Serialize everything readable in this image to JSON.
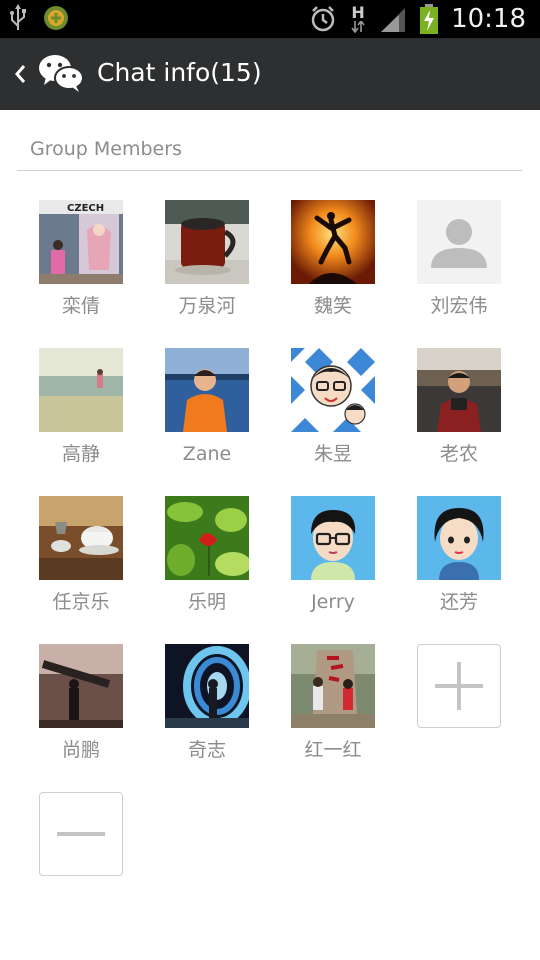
{
  "status_bar": {
    "time": "10:18",
    "network_type": "H",
    "icons": [
      "usb-icon",
      "app-notification-icon",
      "alarm-icon",
      "network-h-icon",
      "signal-icon",
      "battery-charging-icon"
    ]
  },
  "header": {
    "title": "Chat info(15)",
    "back_icon": "back-chevron-icon",
    "logo_icon": "wechat-logo-icon"
  },
  "section": {
    "title": "Group Members"
  },
  "members": [
    {
      "name": "栾倩"
    },
    {
      "name": "万泉河"
    },
    {
      "name": "魏笑"
    },
    {
      "name": "刘宏伟"
    },
    {
      "name": "高静"
    },
    {
      "name": "Zane"
    },
    {
      "name": "朱昱"
    },
    {
      "name": "老农"
    },
    {
      "name": "任京乐"
    },
    {
      "name": "乐明"
    },
    {
      "name": "Jerry"
    },
    {
      "name": "还芳"
    },
    {
      "name": "尚鹏"
    },
    {
      "name": "奇志"
    },
    {
      "name": "红一红"
    }
  ],
  "controls": {
    "add_icon": "plus-icon",
    "remove_icon": "minus-icon"
  },
  "colors": {
    "status_bar": "#000000",
    "action_bar": "#2d2f31",
    "label_gray": "#8c8c8c",
    "divider": "#cfcfcf"
  }
}
